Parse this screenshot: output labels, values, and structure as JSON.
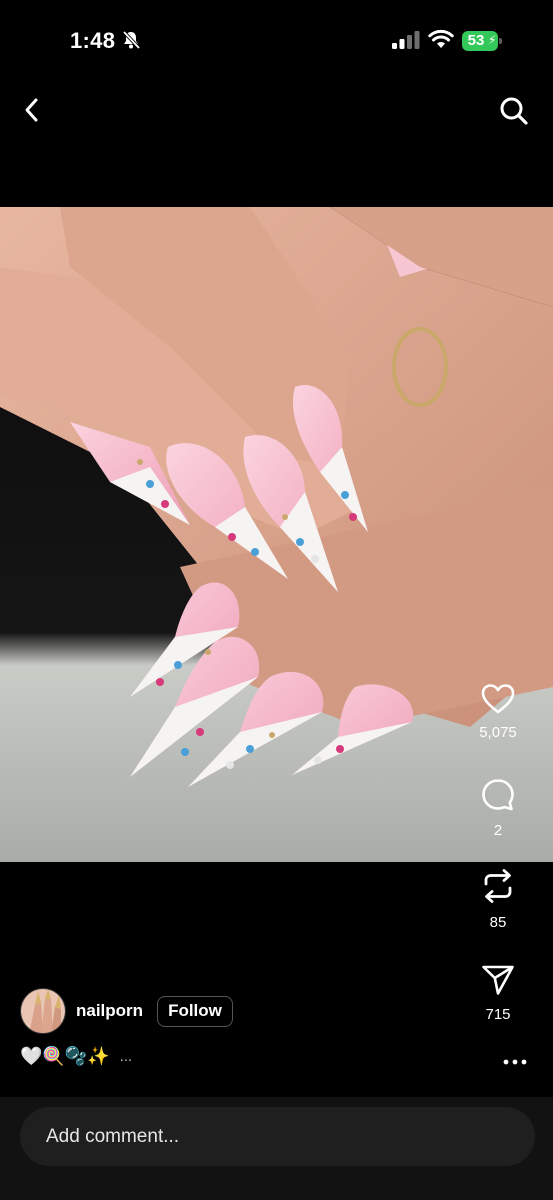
{
  "status_bar": {
    "time": "1:48",
    "battery_level": "53",
    "battery_color": "#34c759"
  },
  "nav": {
    "back_icon": "chevron-left-icon",
    "search_icon": "search-icon"
  },
  "post": {
    "author": {
      "username": "nailporn",
      "follow_label": "Follow"
    },
    "caption": "🤍🍭🫧✨",
    "caption_more": "...",
    "actions": {
      "likes": "5,075",
      "comments": "2",
      "reposts": "85",
      "shares": "715"
    }
  },
  "comment_bar": {
    "placeholder": "Add comment..."
  },
  "colors": {
    "background": "#000000",
    "nail_pink": "#f2b6c8",
    "nail_tip": "#f7f5f4",
    "skin": "#d9a590"
  }
}
